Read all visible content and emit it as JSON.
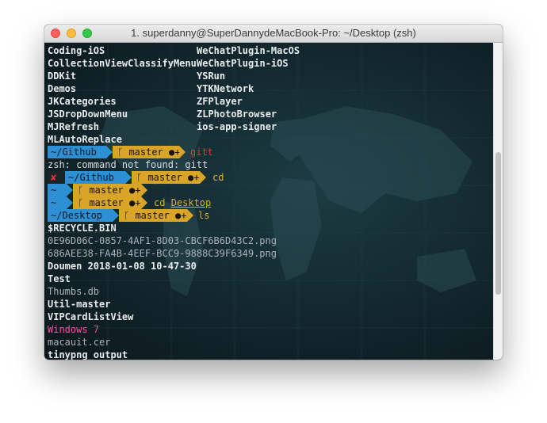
{
  "window": {
    "title": "1. superdanny@SuperDannydeMacBook-Pro: ~/Desktop (zsh)"
  },
  "listing": {
    "col1": [
      "Coding-iOS",
      "CollectionViewClassifyMenu",
      "DDKit",
      "Demos",
      "JKCategories",
      "JSDropDownMenu",
      "MJRefresh",
      "MLAutoReplace"
    ],
    "col2": [
      "WeChatPlugin-MacOS",
      "WeChatPlugin-iOS",
      "YSRun",
      "YTKNetwork",
      "ZFPlayer",
      "ZLPhotoBrowser",
      "ios-app-signer"
    ]
  },
  "prompts": {
    "p1": {
      "dir": "~/Github",
      "branch": "master",
      "dirty": "●+",
      "cmd": "gitt"
    },
    "err": "zsh: command not found: gitt",
    "p2": {
      "x": "✘",
      "dir": "~/Github",
      "branch": "master",
      "dirty": "●+",
      "cmd": "cd"
    },
    "p3": {
      "dir": "~",
      "branch": "master",
      "dirty": "●+"
    },
    "p4": {
      "dir": "~",
      "branch": "master",
      "dirty": "●+",
      "cmd": "cd",
      "arg": "Desktop"
    },
    "p5": {
      "dir": "~/Desktop",
      "branch": "master",
      "dirty": "●+",
      "cmd": "ls"
    }
  },
  "desktop_files": [
    {
      "name": "$RECYCLE.BIN",
      "style": "bold"
    },
    {
      "name": "0E96D06C-0857-4AF1-8D03-CBCF6B6D43C2.png",
      "style": "dim"
    },
    {
      "name": "686AEE38-FA4B-4EEF-BCC9-9888C39F6349.png",
      "style": "dim"
    },
    {
      "name": "Doumen 2018-01-08 10-47-30",
      "style": "bold"
    },
    {
      "name": "Test",
      "style": "bold"
    },
    {
      "name": "Thumbs.db",
      "style": "dim"
    },
    {
      "name": "Util-master",
      "style": "bold"
    },
    {
      "name": "VIPCardListView",
      "style": "bold"
    },
    {
      "name": "Windows 7",
      "style": "pink"
    },
    {
      "name": "macauit.cer",
      "style": "dim"
    },
    {
      "name": "tinypng_output",
      "style": "bold"
    }
  ]
}
